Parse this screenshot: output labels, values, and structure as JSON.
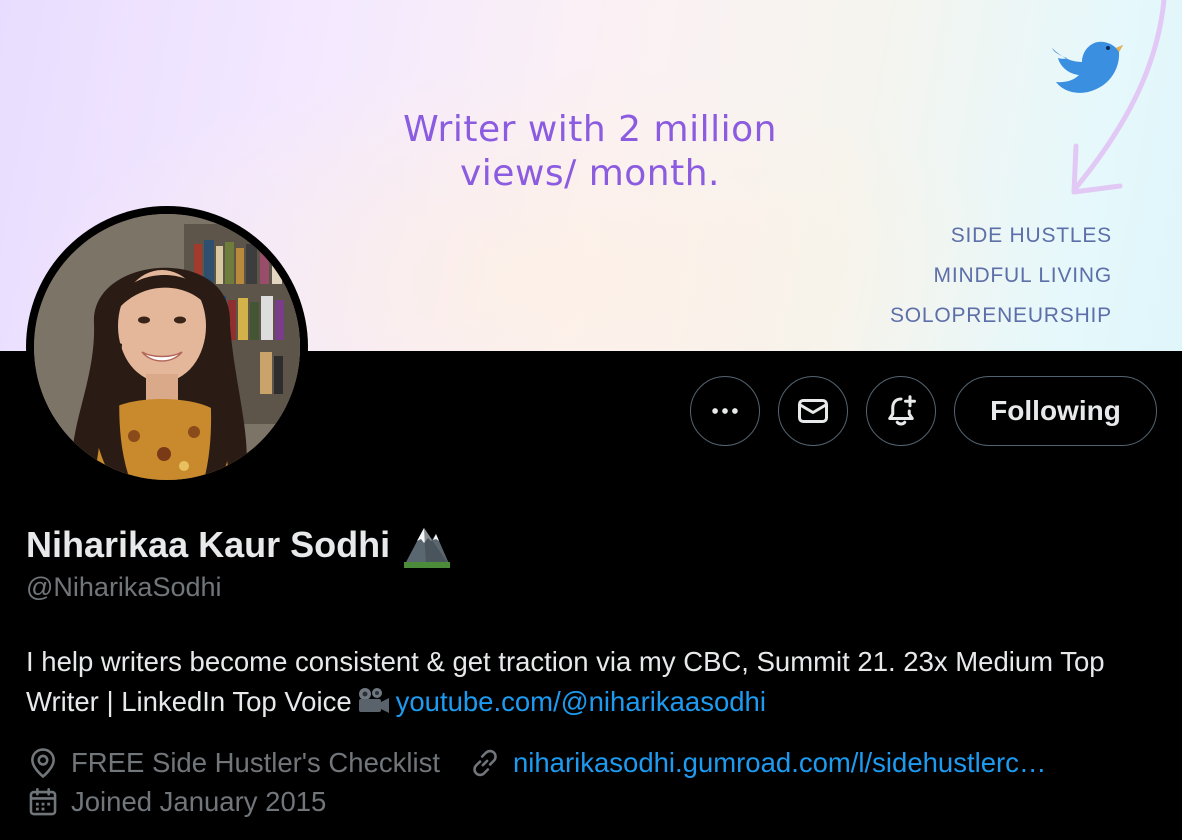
{
  "banner": {
    "tagline_line1": "Writer with 2 million",
    "tagline_line2": "views/ month.",
    "topics": [
      "SIDE HUSTLES",
      "MINDFUL LIVING",
      "SOLOPRENEURSHIP"
    ],
    "icon": "twitter-bird-icon",
    "colors": {
      "tagline": "#8b5be0",
      "topics": "#5c6fa8",
      "bird": "#3b8fe0"
    }
  },
  "profile": {
    "display_name": "Niharikaa Kaur Sodhi",
    "name_emoji": "mountain-icon",
    "handle": "@NiharikaSodhi",
    "bio_text": "I help writers become consistent & get traction via my CBC, Summit 21. 23x Medium Top Writer | LinkedIn Top Voice",
    "bio_emoji": "movie-camera-icon",
    "bio_link": "youtube.com/@niharikaasodhi",
    "location": "FREE Side Hustler's Checklist",
    "website": "niharikasodhi.gumroad.com/l/sidehustlerc…",
    "joined": "Joined January 2015"
  },
  "actions": {
    "more_icon": "more-icon",
    "message_icon": "message-icon",
    "notify_icon": "notification-bell-icon",
    "following_label": "Following"
  },
  "theme": {
    "background": "#000000",
    "text_primary": "#e7e9ea",
    "text_secondary": "#71767b",
    "link": "#1d9bf0",
    "border": "#536471"
  }
}
